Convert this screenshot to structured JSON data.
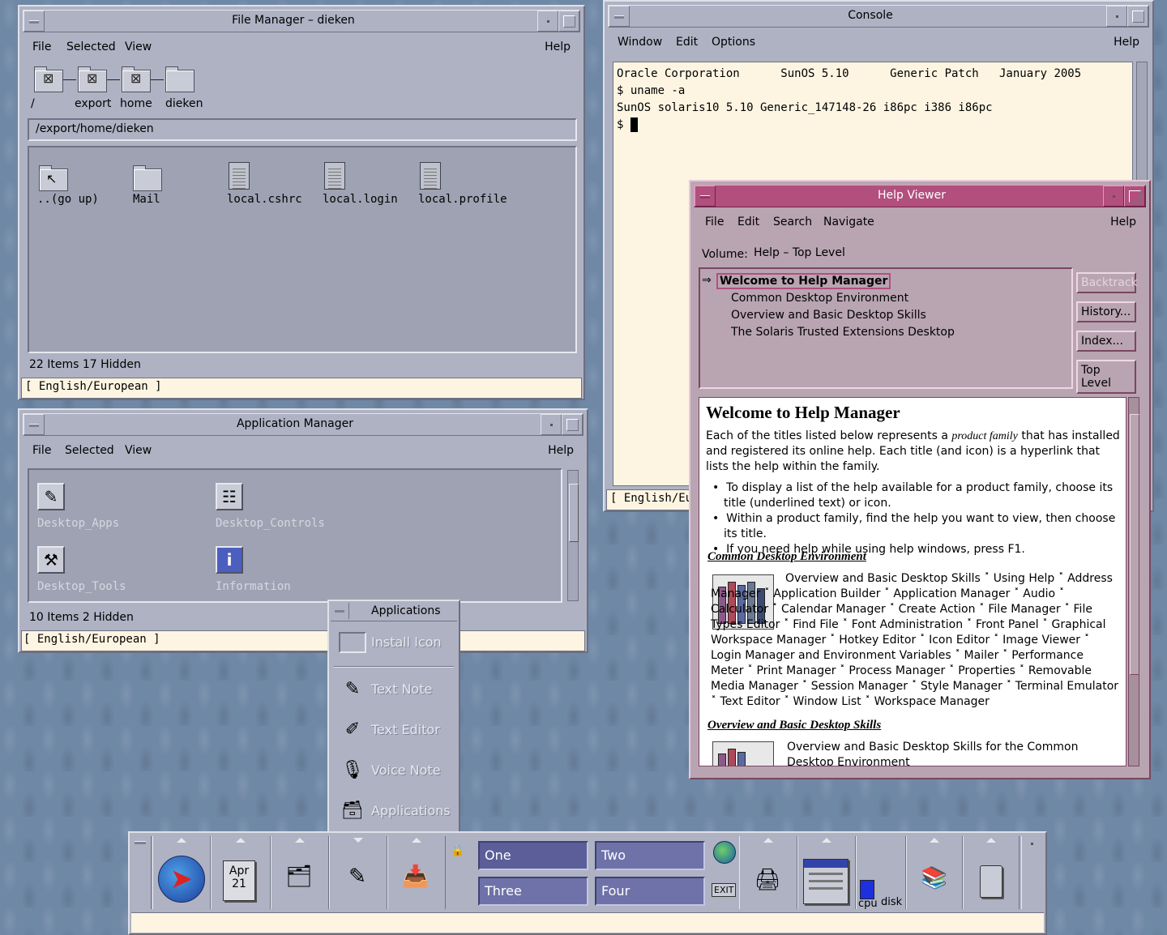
{
  "file_manager": {
    "title": "File Manager – dieken",
    "menus": [
      "File",
      "Selected",
      "View"
    ],
    "help": "Help",
    "path_icons": [
      "/",
      "export",
      "home",
      "dieken"
    ],
    "path": "/export/home/dieken",
    "files": [
      "..(go up)",
      "Mail",
      "local.cshrc",
      "local.login",
      "local.profile"
    ],
    "status": "22 Items 17 Hidden",
    "locale": "[ English/European ]"
  },
  "app_manager": {
    "title": "Application Manager",
    "menus": [
      "File",
      "Selected",
      "View"
    ],
    "help": "Help",
    "apps": [
      "Desktop_Apps",
      "Desktop_Controls",
      "Desktop_Tools",
      "Information"
    ],
    "status": "10 Items 2 Hidden",
    "locale": "[ English/European ]"
  },
  "console": {
    "title": "Console",
    "menus": [
      "Window",
      "Edit",
      "Options"
    ],
    "help": "Help",
    "lines": [
      "Oracle Corporation      SunOS 5.10      Generic Patch   January 2005",
      "$ uname -a",
      "SunOS solaris10 5.10 Generic_147148-26 i86pc i386 i86pc",
      "$ "
    ],
    "locale": "[ English/Eur"
  },
  "help_viewer": {
    "title": "Help Viewer",
    "menus": [
      "File",
      "Edit",
      "Search",
      "Navigate"
    ],
    "help": "Help",
    "volume_label": "Volume:",
    "volume": "Help – Top Level",
    "topics": [
      "Welcome to Help Manager",
      "Common Desktop Environment",
      "Overview and Basic Desktop Skills",
      "The Solaris Trusted Extensions Desktop"
    ],
    "buttons": [
      "Backtrack",
      "History...",
      "Index...",
      "Top Level"
    ],
    "heading": "Welcome to Help Manager",
    "intro_1": "Each of the titles listed below represents a ",
    "intro_em": "product family",
    "intro_2": " that has installed and registered its online help. Each title (and icon) is a hyperlink that lists the help within the family.",
    "bullets": [
      "To display a list of the help available for a product family, choose its title (underlined text) or icon.",
      "Within a product family, find the help you want to view, then choose its title.",
      "If you need help while using help windows, press F1."
    ],
    "section1_title": "Common Desktop Environment",
    "section1_text": "Overview and Basic Desktop Skills ˟ Using Help ˟ Address Manager ˟ Application Builder ˟ Application Manager ˟ Audio ˟ Calculator ˟ Calendar Manager ˟ Create Action ˟ File Manager ˟ File Types Editor ˟ Find File ˟ Font Administration ˟ Front Panel ˟ Graphical Workspace Manager ˟ Hotkey Editor ˟ Icon Editor ˟ Image Viewer ˟ Login Manager and Environment Variables ˟ Mailer ˟ Performance Meter ˟ Print Manager ˟ Process Manager ˟ Properties ˟ Removable Media Manager ˟ Session Manager ˟ Style Manager ˟ Terminal Emulator ˟ Text Editor ˟ Window List ˟ Workspace Manager",
    "section2_title": "Overview and Basic Desktop Skills",
    "section2_text": "Overview and Basic Desktop Skills for the Common Desktop Environment"
  },
  "applications_menu": {
    "title": "Applications",
    "items": [
      "Install Icon",
      "Text Note",
      "Text Editor",
      "Voice Note",
      "Applications"
    ]
  },
  "front_panel": {
    "date_month": "Apr",
    "date_day": "21",
    "workspaces": [
      "One",
      "Two",
      "Three",
      "Four"
    ],
    "exit": "EXIT",
    "meter_labels": [
      "cpu",
      "disk"
    ]
  }
}
